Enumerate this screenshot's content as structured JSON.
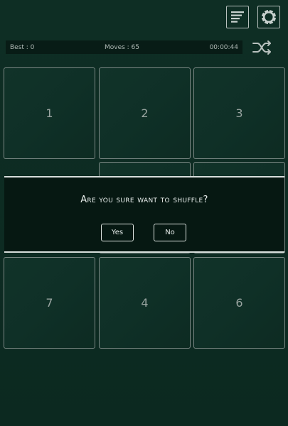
{
  "toolbar": {
    "leaderboard_icon": "leaderboard-icon",
    "settings_icon": "settings-gear-icon"
  },
  "status": {
    "best": "Best : 0",
    "moves": "Moves : 65",
    "time": "00:00:44"
  },
  "tiles": [
    "1",
    "2",
    "3",
    "7",
    "4",
    "6"
  ],
  "dialog": {
    "message": "Are you sure want to shuffle?",
    "yes_label": "Yes",
    "no_label": "No"
  }
}
